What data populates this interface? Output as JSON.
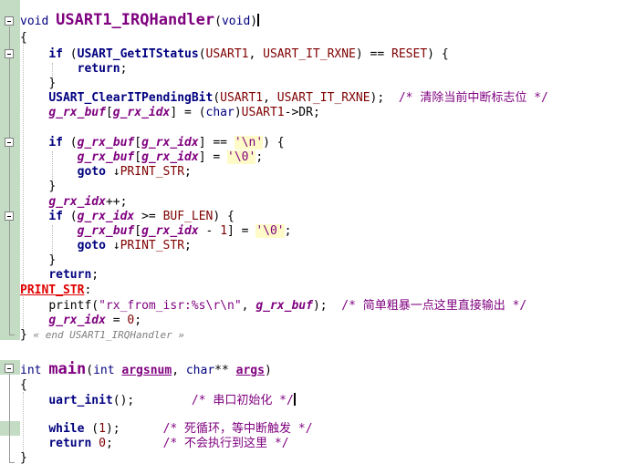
{
  "editor": {
    "lines": {
      "l01": {
        "void": "void",
        "name": "USART1_IRQHandler",
        "lp": "(",
        "arg": "void",
        "rp": ")"
      },
      "l02": {
        "t": "{"
      },
      "l03": {
        "if": "if",
        "p1": " (",
        "fn": "USART_GetITStatus",
        "p2": "(",
        "a1": "USART1",
        ",": ", ",
        "a2": "USART_IT_RXNE",
        "p3": ") == ",
        "a3": "RESET",
        "p4": ") {"
      },
      "l04": {
        "kw": "return",
        ";": ";"
      },
      "l05": {
        "t": "}"
      },
      "l06": {
        "fn": "USART_ClearITPendingBit",
        "p1": "(",
        "a1": "USART1",
        "c": ", ",
        "a2": "USART_IT_RXNE",
        "p2": ");  ",
        "cmt": "/* 清除当前中断标志位 */"
      },
      "l07": {
        "v1": "g_rx_buf",
        "b1": "[",
        "v2": "g_rx_idx",
        "b2": "] = (",
        "ty": "char",
        "rp": ")",
        "a": "USART1",
        "arrow": "->",
        "m": "DR",
        ";": ";"
      },
      "l09": {
        "if": "if",
        "p1": " (",
        "v1": "g_rx_buf",
        "b1": "[",
        "v2": "g_rx_idx",
        "b2": "] == ",
        "ch": "'\\n'",
        "p2": ") {"
      },
      "l10": {
        "v1": "g_rx_buf",
        "b1": "[",
        "v2": "g_rx_idx",
        "b2": "] = ",
        "ch": "'\\0'",
        ";": ";"
      },
      "l11": {
        "kw": "goto",
        "arrow": "↓",
        "lbl": "PRINT_STR",
        ";": ";"
      },
      "l12": {
        "t": "}"
      },
      "l13": {
        "v": "g_rx_idx",
        "op": "++;"
      },
      "l14": {
        "if": "if",
        "p1": " (",
        "v": "g_rx_idx",
        "op": " >= ",
        "mac": "BUF_LEN",
        "p2": ") {"
      },
      "l15": {
        "v1": "g_rx_buf",
        "b1": "[",
        "v2": "g_rx_idx",
        "op": " - ",
        "n": "1",
        "b2": "] = ",
        "ch": "'\\0'",
        ";": ";"
      },
      "l16": {
        "kw": "goto",
        "arrow": "↓",
        "lbl": "PRINT_STR",
        ";": ";"
      },
      "l17": {
        "t": "}"
      },
      "l18": {
        "kw": "return",
        ";": ";"
      },
      "l19": {
        "lbl": "PRINT_STR",
        "c": ":"
      },
      "l20": {
        "fn": "printf",
        "lp": "(",
        "str": "\"rx_from_isr:%s\\r\\n\"",
        "c": ", ",
        "v": "g_rx_buf",
        "rp": ");  ",
        "cmt": "/* 简单粗暴一点这里直接输出 */"
      },
      "l21": {
        "v": "g_rx_idx",
        "op": " = ",
        "n": "0",
        ";": ";"
      },
      "l22": {
        "b": "}",
        "end": " « end USART1_IRQHandler »"
      },
      "l24": {
        "ty": "int",
        "name": "main",
        "lp": "(",
        "t1": "int",
        "a1": "argsnum",
        "c": ", ",
        "t2": "char",
        "st": "**",
        "a2": "args",
        "rp": ")"
      },
      "l25": {
        "t": "{"
      },
      "l26": {
        "fn": "uart_init",
        "p": "();",
        "sp": "        ",
        "cmt": "/* 串口初始化 */"
      },
      "l28": {
        "kw": "while",
        "p": " (",
        "n": "1",
        "p2": ");",
        "sp": "      ",
        "cmt": "/* 死循环，等中断触发 */"
      },
      "l29": {
        "kw": "return",
        "sp1": " ",
        "n": "0",
        ";": ";",
        "sp": "       ",
        "cmt": "/* 不会执行到这里 */"
      },
      "l30": {
        "t": "}"
      }
    }
  }
}
